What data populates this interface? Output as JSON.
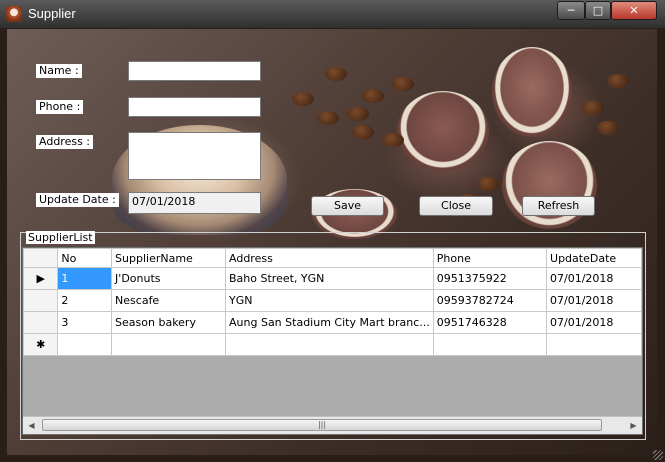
{
  "window": {
    "title": "Supplier",
    "minimize_glyph": "─",
    "maximize_glyph": "□",
    "close_glyph": "✕",
    "icon": "cupcake-app-icon"
  },
  "form": {
    "name_label": "Name :",
    "phone_label": "Phone :",
    "address_label": "Address :",
    "update_date_label": "Update Date :",
    "name_value": "",
    "phone_value": "",
    "address_value": "",
    "update_date_value": "07/01/2018"
  },
  "buttons": {
    "save": "Save",
    "close": "Close",
    "refresh": "Refresh"
  },
  "group": {
    "title": "SupplierList"
  },
  "grid": {
    "columns": [
      "No",
      "SupplierName",
      "Address",
      "Phone",
      "UpdateDate"
    ],
    "rows": [
      {
        "marker": "▶",
        "no": "1",
        "name": "J'Donuts",
        "address": "Baho Street, YGN",
        "phone": "0951375922",
        "date": "07/01/2018"
      },
      {
        "marker": "",
        "no": "2",
        "name": "Nescafe",
        "address": "YGN",
        "phone": "09593782724",
        "date": "07/01/2018"
      },
      {
        "marker": "",
        "no": "3",
        "name": "Season bakery",
        "address": "Aung San Stadium City Mart branc...",
        "phone": "0951746328",
        "date": "07/01/2018"
      }
    ],
    "new_row_marker": "✱",
    "scroll_left": "◀",
    "scroll_right": "▶",
    "scroll_grip": "|||"
  }
}
